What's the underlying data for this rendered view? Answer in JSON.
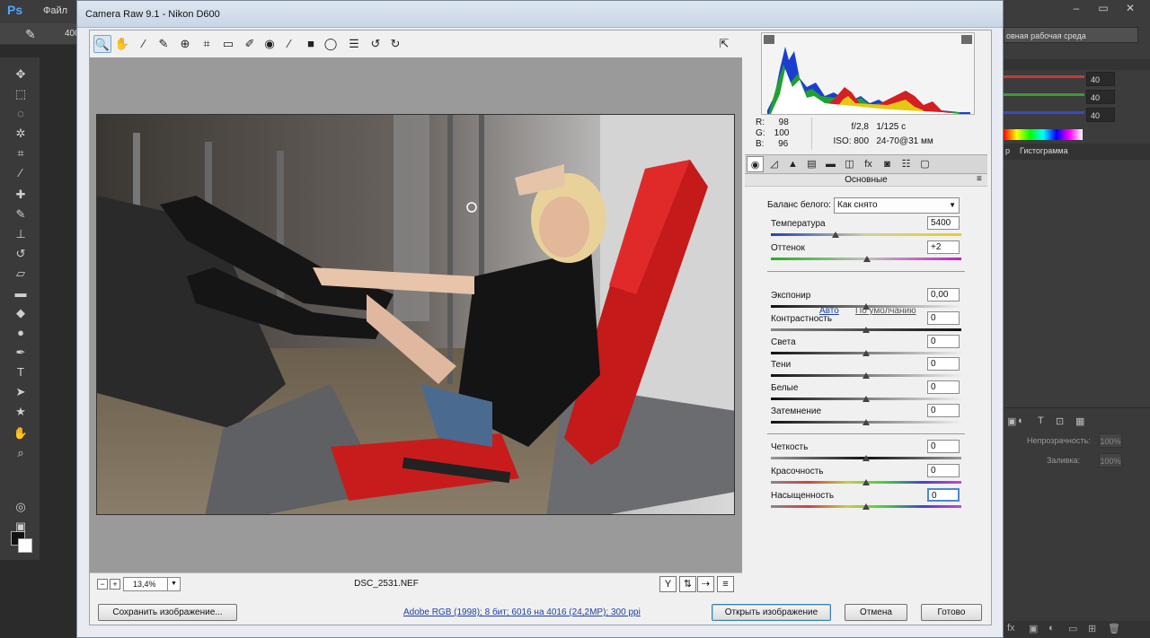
{
  "photoshop": {
    "logo": "Ps",
    "menu_file": "Файл",
    "zoom_value": "400",
    "workspace": "овная рабочая среда",
    "color_values": [
      "40",
      "40",
      "40"
    ],
    "histogram_tab": "Гистограмма",
    "histogram_tab_prefix": "р",
    "opacity_label": "Непрозрачность:",
    "opacity_value": "100%",
    "fill_label": "Заливка:",
    "fill_value": "100%"
  },
  "dialog": {
    "title": "Camera Raw 9.1  -  Nikon D600"
  },
  "histogram": {
    "r_label": "R:",
    "r_value": "98",
    "g_label": "G:",
    "g_value": "100",
    "b_label": "B:",
    "b_value": "96",
    "aperture": "f/2,8",
    "shutter": "1/125 с",
    "iso": "ISO: 800",
    "lens": "24-70@31 мм"
  },
  "panel": {
    "title": "Основные",
    "wb_label": "Баланс белого:",
    "wb_value": "Как снято",
    "auto_link": "Авто",
    "default_link": "По умолчанию",
    "controls": [
      {
        "label": "Температура",
        "value": "5400"
      },
      {
        "label": "Оттенок",
        "value": "+2"
      },
      {
        "label": "Экспонир",
        "value": "0,00"
      },
      {
        "label": "Контрастность",
        "value": "0"
      },
      {
        "label": "Света",
        "value": "0"
      },
      {
        "label": "Тени",
        "value": "0"
      },
      {
        "label": "Белые",
        "value": "0"
      },
      {
        "label": "Затемнение",
        "value": "0"
      },
      {
        "label": "Четкость",
        "value": "0"
      },
      {
        "label": "Красочность",
        "value": "0"
      },
      {
        "label": "Насыщенность",
        "value": "0"
      }
    ]
  },
  "bottombar": {
    "zoom": "13,4%",
    "filename": "DSC_2531.NEF"
  },
  "footer": {
    "save_label": "Сохранить изображение...",
    "workflow_link": "Adobe RGB (1998); 8 бит; 6016 на 4016 (24,2MP); 300 ppi",
    "open_label": "Открыть изображение",
    "cancel_label": "Отмена",
    "done_label": "Готово"
  }
}
